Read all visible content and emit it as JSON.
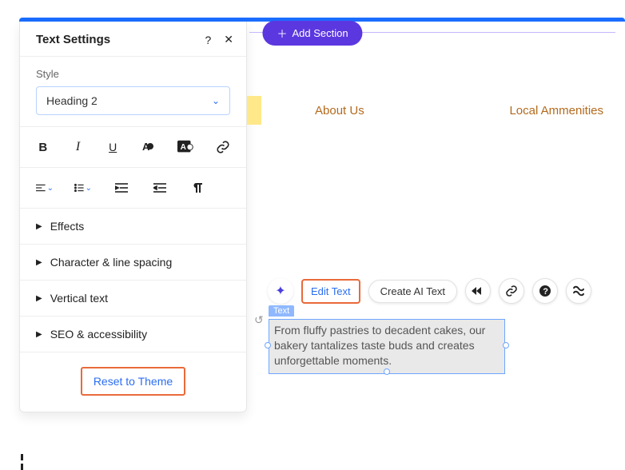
{
  "panel": {
    "title": "Text Settings",
    "style_label": "Style",
    "style_value": "Heading 2",
    "accordion": {
      "effects": "Effects",
      "spacing": "Character & line spacing",
      "vertical": "Vertical text",
      "seo": "SEO & accessibility"
    },
    "reset": "Reset to Theme"
  },
  "canvas": {
    "add_section": "Add Section",
    "nav": {
      "about": "About Us",
      "local": "Local Ammenities"
    },
    "toolbar": {
      "edit_text": "Edit Text",
      "create_ai": "Create AI Text"
    },
    "text_tag": "Text",
    "text_body": "From fluffy pastries to decadent cakes, our bakery tantalizes taste buds and creates unforgettable moments."
  }
}
